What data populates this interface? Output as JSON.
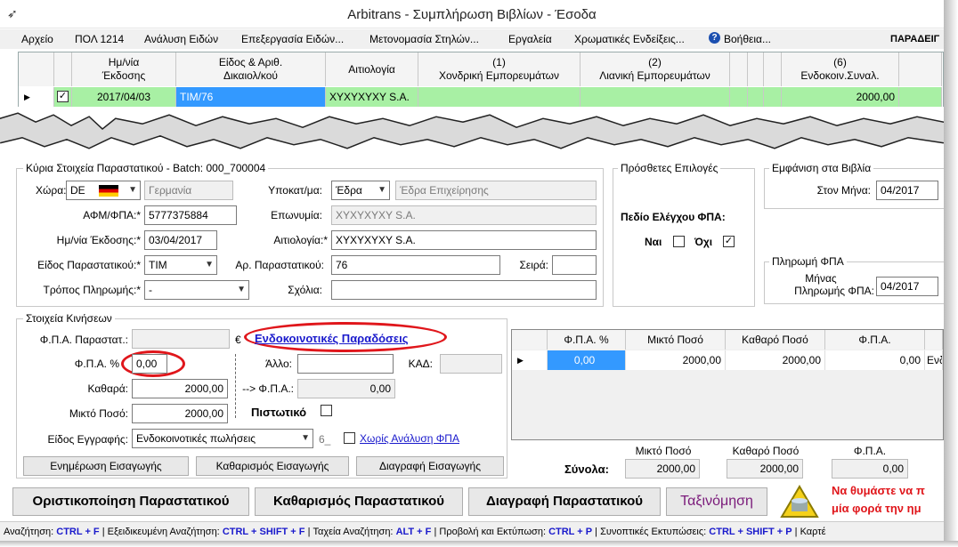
{
  "window": {
    "title": "Arbitrans - Συμπλήρωση Βιβλίων - Έσοδα",
    "icon": "eagle-icon"
  },
  "menu": [
    "Αρχείο",
    "ΠΟΛ 1214",
    "Ανάλυση Ειδών",
    "Επεξεργασία Ειδών...",
    "Μετονομασία Στηλών...",
    "Εργαλεία",
    "Χρωματικές Ενδείξεις...",
    "Βοήθεια...",
    "ΠΑΡΑΔΕΙΓ"
  ],
  "top_grid": {
    "headers": [
      "Ημ/νία\nΈκδοσης",
      "Είδος & Αριθ.\nΔικαιολ/κού",
      "Αιτιολογία",
      "(1)\nΧονδρική Εμπορευμάτων",
      "(2)\nΛιανική Εμπορευμάτων",
      "(6)\nΕνδοκοιν.Συναλ."
    ],
    "row": {
      "checked": "✓",
      "date": "2017/04/03",
      "doc": "TIM/76",
      "reason": "XYXYXYXY S.A.",
      "value6": "2000,00"
    }
  },
  "main": {
    "group_title": "Κύρια Στοιχεία Παραστατικού - Batch: 000_700004",
    "country_label": "Χώρα:",
    "country_code": "DE",
    "country_name": "Γερμανία",
    "branch_label": "Υποκατ/μα:",
    "branch_value": "Έδρα",
    "branch_name": "Έδρα Επιχείρησης",
    "vat_label": "ΑΦΜ/ΦΠΑ:*",
    "vat_value": "5777375884",
    "name_label": "Επωνυμία:",
    "name_value": "XYXYXYXY S.A.",
    "date_label": "Ημ/νία Έκδοσης:*",
    "date_value": "03/04/2017",
    "reason_label": "Αιτιολογία:*",
    "reason_value": "XYXYXYXY S.A.",
    "type_label": "Είδος Παραστατικού:*",
    "type_value": "TIM",
    "docnum_label": "Αρ. Παραστατικού:",
    "docnum_value": "76",
    "series_label": "Σειρά:",
    "payment_label": "Τρόπος Πληρωμής:*",
    "payment_value": "-",
    "comments_label": "Σχόλια:"
  },
  "options": {
    "title": "Πρόσθετες Επιλογές",
    "vat_check": "Πεδίο Ελέγχου ΦΠΑ:",
    "yes": "Ναι",
    "no": "Όχι",
    "no_checked": "✓"
  },
  "books": {
    "title": "Εμφάνιση στα Βιβλία",
    "month_label": "Στον Μήνα:",
    "month_value": "04/2017"
  },
  "vat_payment": {
    "title": "Πληρωμή ΦΠΑ",
    "label1": "Μήνας",
    "label2": "Πληρωμής ΦΠΑ:",
    "value": "04/2017"
  },
  "moves": {
    "title": "Στοιχεία Κινήσεων",
    "vat_doc_label": "Φ.Π.Α. Παραστατ.:",
    "euro": "€",
    "link": "Ενδοκοινοτικές Παραδόσεις",
    "vat_pct_label": "Φ.Π.Α. %",
    "vat_pct_value": "0,00",
    "other_label": "Άλλο:",
    "kad_label": "ΚΑΔ:",
    "net_label": "Καθαρά:",
    "net_value": "2000,00",
    "arrow_vat_label": "--> Φ.Π.Α.:",
    "arrow_vat_value": "0,00",
    "gross_label": "Μικτό Ποσό:",
    "gross_value": "2000,00",
    "credit_label": "Πιστωτικό",
    "entry_type_label": "Είδος Εγγραφής:",
    "entry_type_value": "Ενδοκοινοτικές πωλήσεις",
    "entry_code": "6_",
    "no_analysis": "Χωρίς Ανάλυση ΦΠΑ",
    "btn_update": "Ενημέρωση Εισαγωγής",
    "btn_clear": "Καθαρισμός Εισαγωγής",
    "btn_delete": "Διαγραφή Εισαγωγής"
  },
  "vat_grid": {
    "headers": [
      "Φ.Π.Α. %",
      "Μικτό Ποσό",
      "Καθαρό Ποσό",
      "Φ.Π.Α."
    ],
    "row": [
      "0,00",
      "2000,00",
      "2000,00",
      "0,00",
      "Ενδ"
    ]
  },
  "totals": {
    "label": "Σύνολα:",
    "h_gross": "Μικτό Ποσό",
    "h_net": "Καθαρό Ποσό",
    "h_vat": "Φ.Π.Α.",
    "gross": "2000,00",
    "net": "2000,00",
    "vat": "0,00"
  },
  "actions": {
    "finalize": "Οριστικοποίηση Παραστατικού",
    "clear": "Καθαρισμός Παραστατικού",
    "delete": "Διαγραφή Παραστατικού",
    "sort": "Ταξινόμηση"
  },
  "reminder": {
    "line1": "Να θυμάστε να π",
    "line2": "μία φορά την ημ"
  },
  "status": [
    {
      "label": "Αναζήτηση:",
      "key": "CTRL + F"
    },
    {
      "label": "Εξειδικευμένη Αναζήτηση:",
      "key": "CTRL + SHIFT + F"
    },
    {
      "label": "Ταχεία Αναζήτηση:",
      "key": "ALT + F"
    },
    {
      "label": "Προβολή και Εκτύπωση:",
      "key": "CTRL + P"
    },
    {
      "label": "Συνοπτικές Εκτυπώσεις:",
      "key": "CTRL + SHIFT + P"
    },
    {
      "label": "Καρτέ",
      "key": ""
    }
  ],
  "colors": {
    "row_green": "#a8f0a4",
    "selected_blue": "#3399ff",
    "red_highlight": "#e0161b",
    "link_blue": "#1a1acc"
  }
}
